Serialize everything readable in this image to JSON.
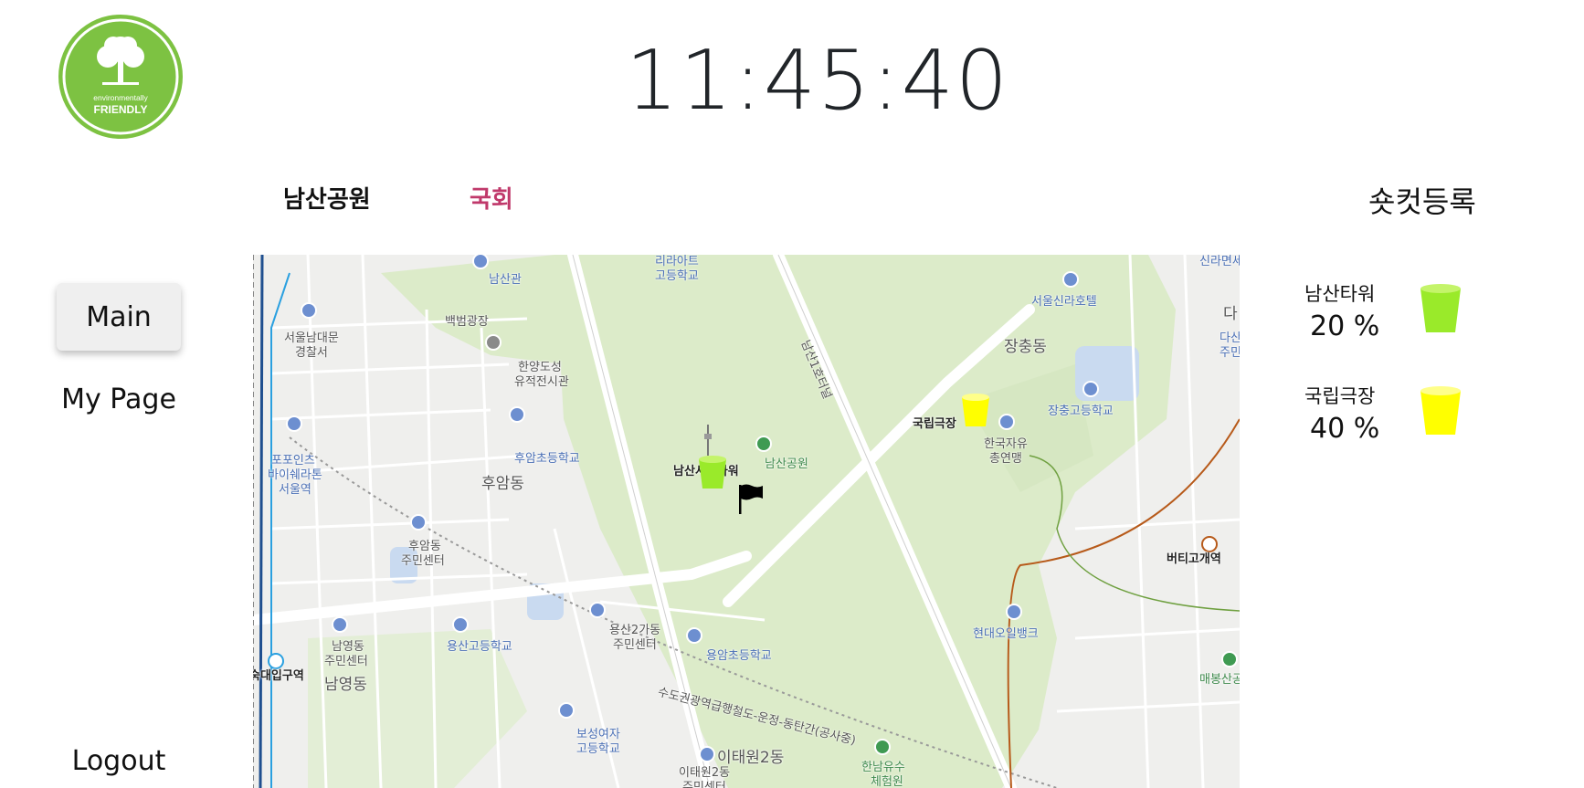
{
  "logo": {
    "line1": "environmentally",
    "line2": "FRIENDLY",
    "color": "#7dc242"
  },
  "clock": "11:45:40",
  "tabs": [
    {
      "label": "남산공원",
      "color": "#111111"
    },
    {
      "label": "국회",
      "color": "#c0396b"
    }
  ],
  "shortcut_label": "숏컷등록",
  "sidebar": {
    "main": "Main",
    "mypage": "My Page",
    "logout": "Logout"
  },
  "map": {
    "labels": {
      "namsangwan": "남산관",
      "liraart": "리라아트",
      "liraart2": "고등학교",
      "baekbeom": "백범광장",
      "seoulnamdaemun1": "서울남대문",
      "seoulnamdaemun2": "경찰서",
      "hanyang1": "한양도성",
      "hanyang2": "유적전시관",
      "huam_school": "후암초등학교",
      "huamdong": "후암동",
      "fourpoints1": "포포인츠",
      "fourpoints2": "바이쉐라톤",
      "fourpoints3": "서울역",
      "huam_center1": "후암동",
      "huam_center2": "주민센터",
      "namyeong_center1": "남영동",
      "namyeong_center2": "주민센터",
      "namyeongdong": "남영동",
      "sookdae": "숙대입구역",
      "yongsan_high": "용산고등학교",
      "yongsan2_1": "용산2가동",
      "yongsan2_2": "주민센터",
      "yongam": "용암초등학교",
      "boseong1": "보성여자",
      "boseong2": "고등학교",
      "itaewon2": "이태원2동",
      "itaewon2c1": "이태원2동",
      "itaewon2c2": "주민센터",
      "railway": "수도권광역급행철도-운정-동탄간(공사중)",
      "namsan_tower": "남산서울타워",
      "namsan_park": "남산공원",
      "tunnel": "남산1호터널",
      "hannam1": "한남유수",
      "hannam2": "체험원",
      "hyundai": "현대오일뱅크",
      "butigogae": "버티고개역",
      "maebong": "매봉산공",
      "seoul_shilla": "서울신라호텔",
      "jangchung": "장충동",
      "jangchung_high": "장충고등학교",
      "national_theater": "국립극장",
      "kfreedom1": "한국자유",
      "kfreedom2": "총연맹",
      "shinla_top": "신라면세",
      "dasan": "다",
      "dasan2": "주민",
      "sinsang": "다산"
    }
  },
  "bins": [
    {
      "name": "남산타워",
      "percent": "20 %",
      "fill": 0.2,
      "color": "#9aea2a"
    },
    {
      "name": "국립극장",
      "percent": "40 %",
      "fill": 0.4,
      "color": "#ffff00"
    }
  ]
}
